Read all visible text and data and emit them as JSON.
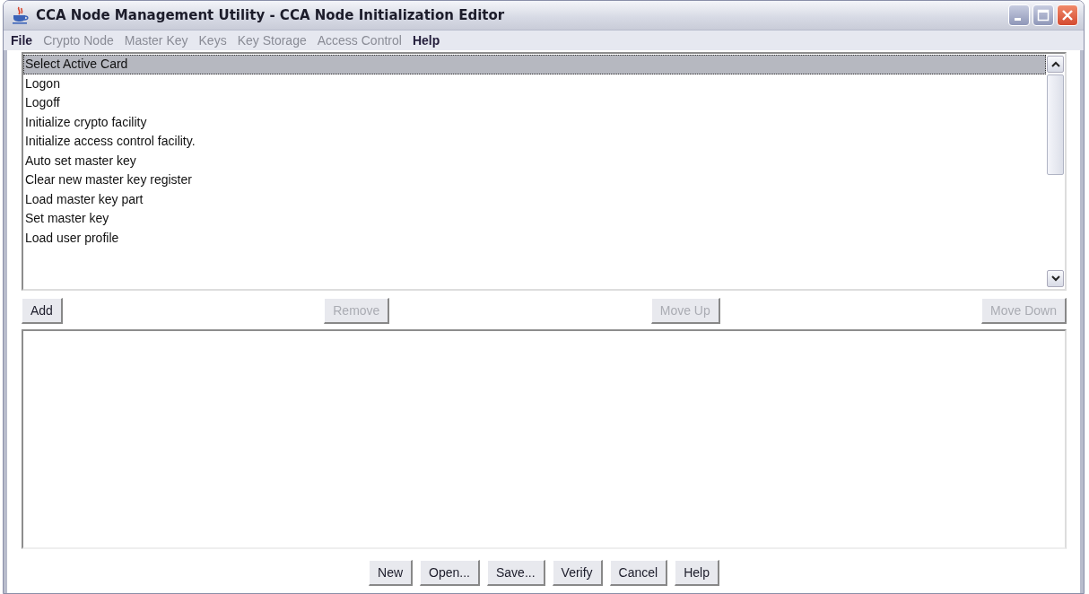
{
  "window": {
    "title": "CCA Node Management Utility - CCA Node Initialization Editor"
  },
  "menu": [
    {
      "label": "File",
      "disabled": false
    },
    {
      "label": "Crypto Node",
      "disabled": true
    },
    {
      "label": "Master Key",
      "disabled": true
    },
    {
      "label": "Keys",
      "disabled": true
    },
    {
      "label": "Key Storage",
      "disabled": true
    },
    {
      "label": "Access Control",
      "disabled": true
    },
    {
      "label": "Help",
      "disabled": false
    }
  ],
  "list": [
    {
      "label": "Select Active Card",
      "selected": true
    },
    {
      "label": "Logon",
      "selected": false
    },
    {
      "label": "Logoff",
      "selected": false
    },
    {
      "label": "Initialize crypto facility",
      "selected": false
    },
    {
      "label": "Initialize access control facility.",
      "selected": false
    },
    {
      "label": "Auto set master key",
      "selected": false
    },
    {
      "label": "Clear new master key register",
      "selected": false
    },
    {
      "label": "Load master key part",
      "selected": false
    },
    {
      "label": "Set master key",
      "selected": false
    },
    {
      "label": "Load user profile",
      "selected": false
    }
  ],
  "list_buttons": [
    {
      "label": "Add",
      "disabled": false
    },
    {
      "label": "Remove",
      "disabled": true
    },
    {
      "label": "Move Up",
      "disabled": true
    },
    {
      "label": "Move Down",
      "disabled": true
    }
  ],
  "buttons": [
    {
      "label": "New"
    },
    {
      "label": "Open..."
    },
    {
      "label": "Save..."
    },
    {
      "label": "Verify"
    },
    {
      "label": "Cancel"
    },
    {
      "label": "Help"
    }
  ]
}
